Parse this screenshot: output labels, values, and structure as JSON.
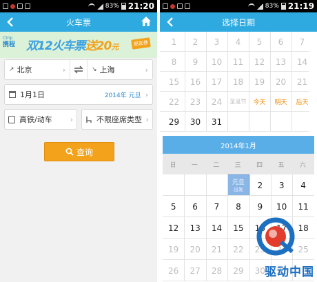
{
  "left_screen": {
    "status": {
      "battery": "83%",
      "time": "21:20"
    },
    "appbar": {
      "title": "火车票"
    },
    "banner": {
      "logo_small": "Ctrip",
      "logo_main": "携程",
      "promo_a": "双12火车票",
      "promo_b": "送20",
      "promo_unit": "元",
      "badge": "朋友券"
    },
    "route": {
      "from": "北京",
      "to": "上海"
    },
    "date": {
      "value": "1月1日",
      "note": "2014年 元旦"
    },
    "train_type": "高铁/动车",
    "seat_type": "不限座席类型",
    "search_label": "查询"
  },
  "right_screen": {
    "status": {
      "battery": "83%",
      "time": "21:19"
    },
    "appbar": {
      "title": "选择日期"
    },
    "dec_rows": [
      [
        "1",
        "2",
        "3",
        "4",
        "5",
        "6",
        "7"
      ],
      [
        "8",
        "9",
        "10",
        "11",
        "12",
        "13",
        "14"
      ],
      [
        "15",
        "16",
        "17",
        "18",
        "19",
        "20",
        "21"
      ],
      [
        "22",
        "23",
        "24",
        "圣诞节",
        "今天",
        "明天",
        "后天"
      ],
      [
        "29",
        "30",
        "31",
        "",
        "",
        "",
        ""
      ]
    ],
    "month_title": "2014年1月",
    "weekdays": [
      "日",
      "一",
      "二",
      "三",
      "四",
      "五",
      "六"
    ],
    "jan_rows": [
      [
        "",
        "",
        "",
        "元旦",
        "2",
        "3",
        "4"
      ],
      [
        "5",
        "6",
        "7",
        "8",
        "9",
        "10",
        "11"
      ],
      [
        "12",
        "13",
        "14",
        "15",
        "16",
        "17",
        "18"
      ],
      [
        "19",
        "20",
        "21",
        "22",
        "23",
        "24",
        "25"
      ],
      [
        "26",
        "27",
        "28",
        "29",
        "30",
        "31",
        ""
      ]
    ],
    "selected_sub": "出发",
    "watermark": "驱动中国"
  }
}
